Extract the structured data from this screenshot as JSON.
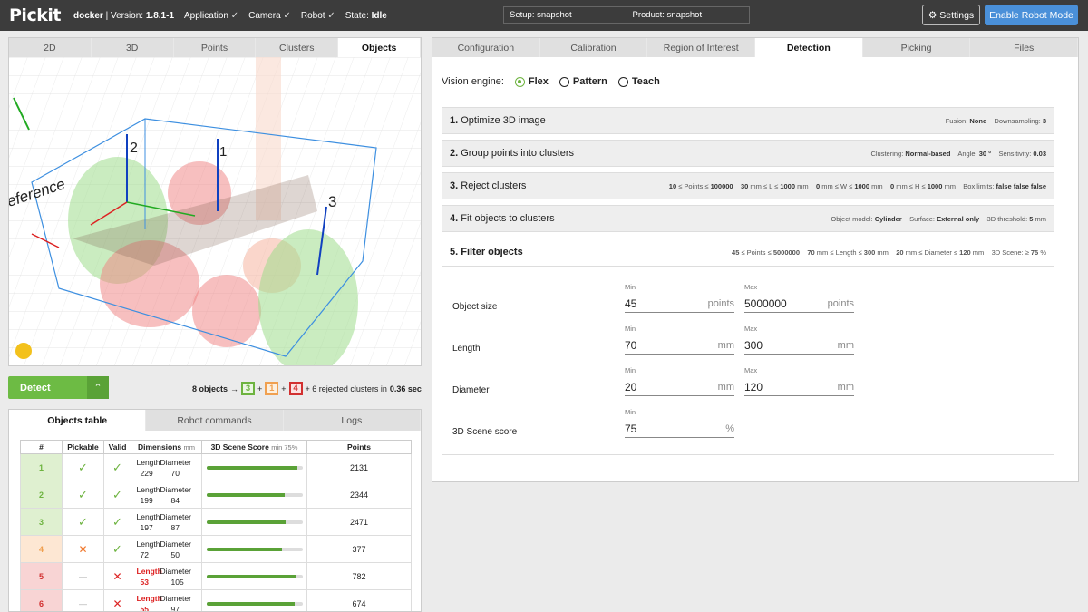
{
  "app": {
    "logo": "Pickit",
    "version_prefix": "docker",
    "version_label": "Version:",
    "version": "1.8.1-1",
    "application": "Application",
    "camera": "Camera",
    "robot": "Robot",
    "state_label": "State:",
    "state": "Idle",
    "check": "✓"
  },
  "setup": {
    "setup_label": "Setup:",
    "setup": "snapshot",
    "product_label": "Product:",
    "product": "snapshot"
  },
  "buttons": {
    "settings": "Settings",
    "settings_icon": "⚙",
    "robot_mode": "Enable Robot Mode"
  },
  "left_tabs": [
    "2D",
    "3D",
    "Points",
    "Clusters",
    "Objects"
  ],
  "viewer": {
    "label_reference": "eference",
    "labels": [
      "1",
      "2",
      "3"
    ]
  },
  "detect": {
    "label": "Detect",
    "drop": "⌃"
  },
  "summary": {
    "objects": "8 objects",
    "arrow": "→",
    "g": "3",
    "o": "1",
    "r": "4",
    "plus": "+",
    "rejected_pre": "+ 6 rejected clusters in",
    "time": "0.36 sec"
  },
  "bottom_tabs": [
    "Objects table",
    "Robot commands",
    "Logs"
  ],
  "table": {
    "headers": [
      "#",
      "Pickable",
      "Valid",
      "Dimensions",
      "3D Scene Score",
      "Points"
    ],
    "dim_unit": "mm",
    "score_min": "min 75%",
    "len_label": "Length",
    "dia_label": "Diameter",
    "rows": [
      {
        "num": "1",
        "pick": "✓",
        "valid": "✓",
        "length": "229",
        "diameter": "70",
        "score": 0.95,
        "points": "2131"
      },
      {
        "num": "2",
        "pick": "✓",
        "valid": "✓",
        "length": "199",
        "diameter": "84",
        "score": 0.82,
        "points": "2344"
      },
      {
        "num": "3",
        "pick": "✓",
        "valid": "✓",
        "length": "197",
        "diameter": "87",
        "score": 0.83,
        "points": "2471"
      },
      {
        "num": "4",
        "pick": "✕",
        "valid": "✓",
        "length": "72",
        "diameter": "50",
        "score": 0.79,
        "points": "377"
      },
      {
        "num": "5",
        "pick": "—",
        "valid": "✕",
        "length": "53",
        "diameter": "105",
        "score": 0.94,
        "points": "782"
      },
      {
        "num": "6",
        "pick": "—",
        "valid": "✕",
        "length": "55",
        "diameter": "97",
        "score": 0.92,
        "points": "674"
      }
    ]
  },
  "right_tabs": [
    "Configuration",
    "Calibration",
    "Region of Interest",
    "Detection",
    "Picking",
    "Files"
  ],
  "vision": {
    "label": "Vision engine:",
    "options": [
      "Flex",
      "Pattern",
      "Teach"
    ]
  },
  "steps": [
    {
      "n": "1.",
      "title": "Optimize 3D image",
      "params": "Fusion: <b>None</b> &nbsp;&nbsp; Downsampling: <b>3</b>"
    },
    {
      "n": "2.",
      "title": "Group points into clusters",
      "params": "Clustering: <b>Normal-based</b> &nbsp;&nbsp; Angle: <b>30 °</b> &nbsp;&nbsp; Sensitivity: <b>0.03</b>"
    },
    {
      "n": "3.",
      "title": "Reject clusters",
      "params": "<b>10</b> ≤ Points ≤ <b>100000</b> &nbsp;&nbsp; <b>30</b> mm ≤ L ≤ <b>1000</b> mm &nbsp;&nbsp; <b>0</b> mm ≤ W ≤ <b>1000</b> mm &nbsp;&nbsp; <b>0</b> mm ≤ H ≤ <b>1000</b> mm &nbsp;&nbsp; Box limits: <b>false false false</b>"
    },
    {
      "n": "4.",
      "title": "Fit objects to clusters",
      "params": "Object model: <b>Cylinder</b> &nbsp;&nbsp; Surface: <b>External only</b> &nbsp;&nbsp; 3D threshold: <b>5</b> mm"
    }
  ],
  "filter": {
    "title": "5. Filter objects",
    "params": "<b>45</b> ≤ Points ≤ <b>5000000</b> &nbsp;&nbsp; <b>70</b> mm ≤ Length ≤ <b>300</b> mm &nbsp;&nbsp; <b>20</b> mm ≤ Diameter ≤ <b>120</b> mm &nbsp;&nbsp; 3D Scene: ≥ <b>75</b> %",
    "min_label": "Min",
    "max_label": "Max",
    "rows": [
      {
        "label": "Object size",
        "min": "45",
        "max": "5000000",
        "unit": "points"
      },
      {
        "label": "Length",
        "min": "70",
        "max": "300",
        "unit": "mm"
      },
      {
        "label": "Diameter",
        "min": "20",
        "max": "120",
        "unit": "mm"
      },
      {
        "label": "3D Scene score",
        "min": "75",
        "unit": "%"
      }
    ]
  },
  "colors": {
    "green": "#6db33f",
    "orange": "#f0a050",
    "red": "#d23030",
    "blue": "#4a90d9"
  }
}
